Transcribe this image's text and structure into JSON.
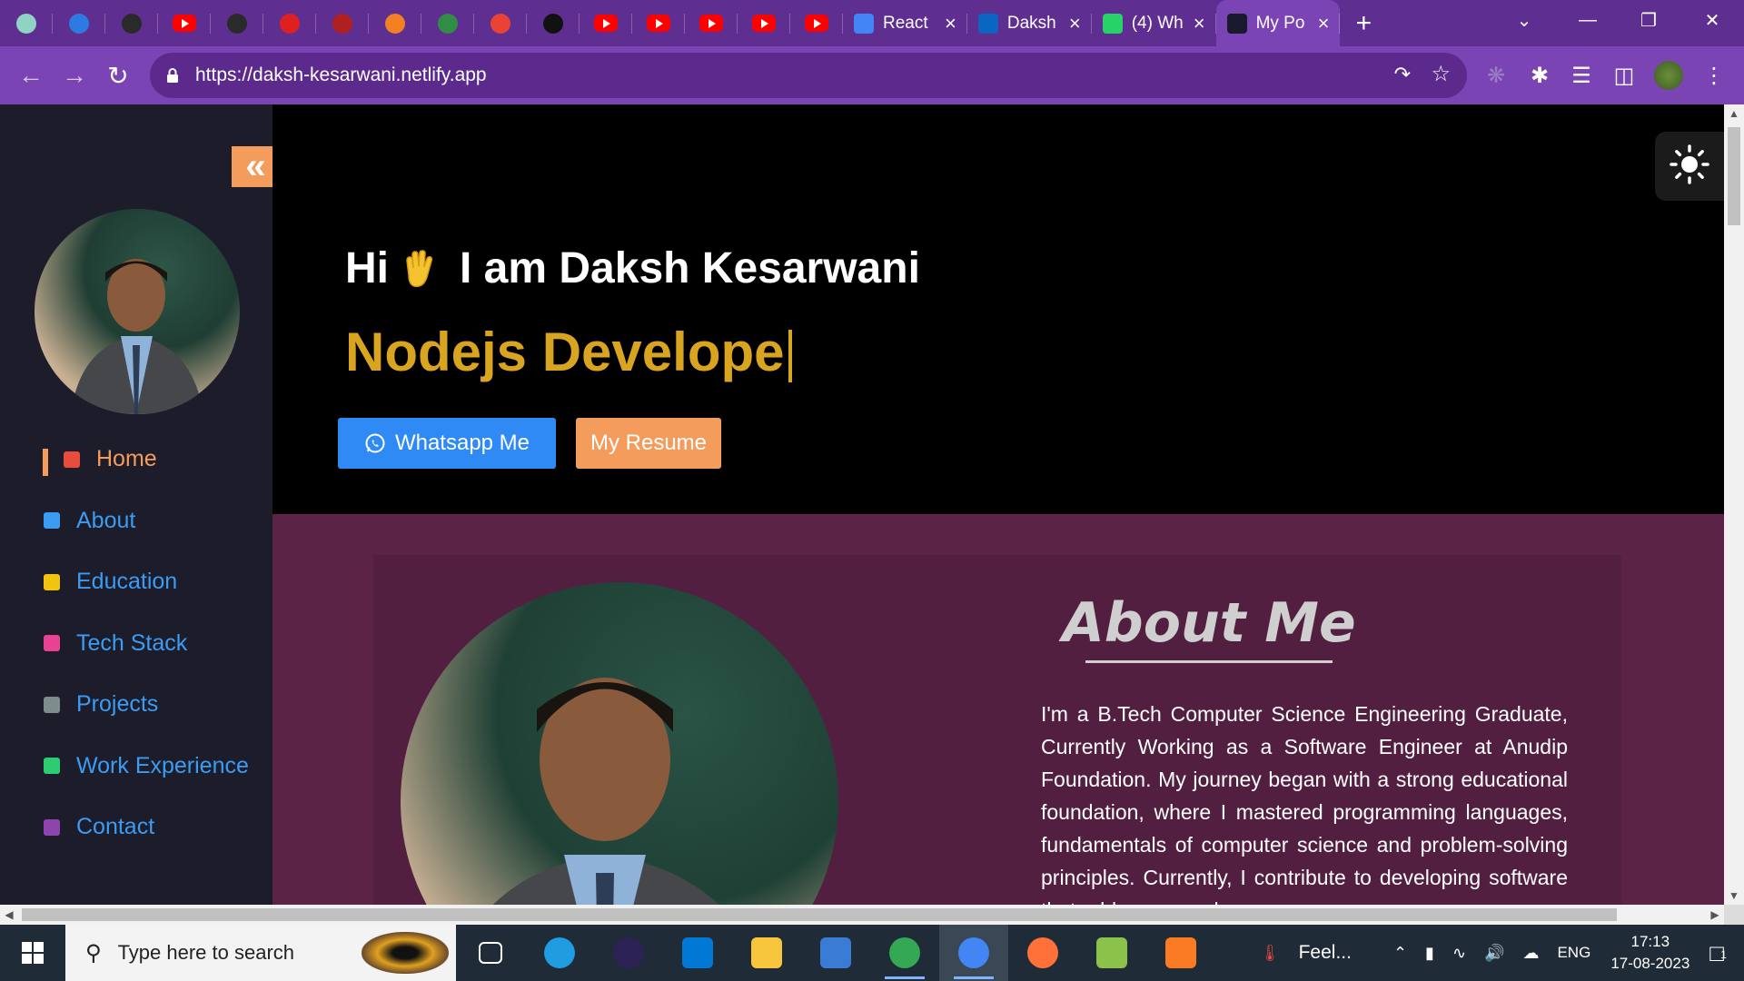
{
  "browser": {
    "pinned_tabs": [
      {
        "icon": "chatgpt-icon",
        "color": "#8fd3c4"
      },
      {
        "icon": "jira-icon",
        "color": "#2d7be0"
      },
      {
        "icon": "globe-icon",
        "color": "#2a2a2a"
      },
      {
        "icon": "youtube-icon",
        "color": "#ff0000"
      },
      {
        "icon": "globe-icon",
        "color": "#2a2a2a"
      },
      {
        "icon": "vercel-icon",
        "color": "#e02020"
      },
      {
        "icon": "person-icon",
        "color": "#b02020"
      },
      {
        "icon": "stackoverflow-icon",
        "color": "#f48024"
      },
      {
        "icon": "geeksforgeeks-icon",
        "color": "#2f8d46"
      },
      {
        "icon": "gmail-icon",
        "color": "#ea4335"
      },
      {
        "icon": "github-icon",
        "color": "#111111"
      },
      {
        "icon": "youtube-icon",
        "color": "#ff0000"
      },
      {
        "icon": "youtube-icon",
        "color": "#ff0000"
      },
      {
        "icon": "youtube-icon",
        "color": "#ff0000"
      },
      {
        "icon": "youtube-icon",
        "color": "#ff0000"
      },
      {
        "icon": "youtube-icon",
        "color": "#ff0000"
      }
    ],
    "tabs": [
      {
        "label": "React",
        "icon": "docs-icon"
      },
      {
        "label": "Daksh",
        "icon": "linkedin-icon"
      },
      {
        "label": "(4) Wh",
        "icon": "whatsapp-icon"
      },
      {
        "label": "My Po",
        "icon": "react-icon",
        "active": true
      }
    ],
    "new_tab": "+",
    "url": "https://daksh-kesarwani.netlify.app"
  },
  "sidebar": {
    "collapse_label": "«",
    "nav": [
      {
        "label": "Home",
        "icon": "home-icon",
        "icon_color": "#e74c3c",
        "active": true
      },
      {
        "label": "About",
        "icon": "info-icon",
        "icon_color": "#3b9cf4"
      },
      {
        "label": "Education",
        "icon": "student-icon",
        "icon_color": "#f1c40f"
      },
      {
        "label": "Tech Stack",
        "icon": "hourglass-icon",
        "icon_color": "#e84393"
      },
      {
        "label": "Projects",
        "icon": "gamepad-icon",
        "icon_color": "#7f8c8d"
      },
      {
        "label": "Work Experience",
        "icon": "worker-icon",
        "icon_color": "#2ecc71"
      },
      {
        "label": "Contact",
        "icon": "contact-card-icon",
        "icon_color": "#8e44ad"
      }
    ]
  },
  "hero": {
    "greeting_prefix": "Hi",
    "greeting_suffix": "I am Daksh Kesarwani",
    "typed_role": "Nodejs Develope",
    "whatsapp_button": "Whatsapp Me",
    "resume_button": "My Resume"
  },
  "about": {
    "title": "About Me",
    "text": "I'm a B.Tech Computer Science Engineering Graduate, Currently Working as a Software Engineer at Anudip Foundation. My journey began with a strong educational foundation, where I mastered programming languages, fundamentals of computer science and problem-solving principles. Currently, I contribute to developing software that addresses real-"
  },
  "taskbar": {
    "search_placeholder": "Type here to search",
    "apps": [
      {
        "icon": "task-view-icon",
        "color": "#ffffff"
      },
      {
        "icon": "edge-icon",
        "color": "#1f9de0"
      },
      {
        "icon": "eclipse-icon",
        "color": "#2c2255"
      },
      {
        "icon": "vscode-icon",
        "color": "#0078d4"
      },
      {
        "icon": "file-explorer-icon",
        "color": "#f8c63d"
      },
      {
        "icon": "network-icon",
        "color": "#3a7bd5"
      },
      {
        "icon": "chrome-icon",
        "color": "#34a853"
      },
      {
        "icon": "chrome-icon",
        "color": "#4285f4"
      },
      {
        "icon": "firefox-icon",
        "color": "#ff7139"
      },
      {
        "icon": "notepad-plus-icon",
        "color": "#8bc34a"
      },
      {
        "icon": "xampp-icon",
        "color": "#fb7a24"
      }
    ],
    "weather": "Feel...",
    "lang": "ENG",
    "time": "17:13",
    "date": "17-08-2023",
    "notif_count": "1"
  }
}
